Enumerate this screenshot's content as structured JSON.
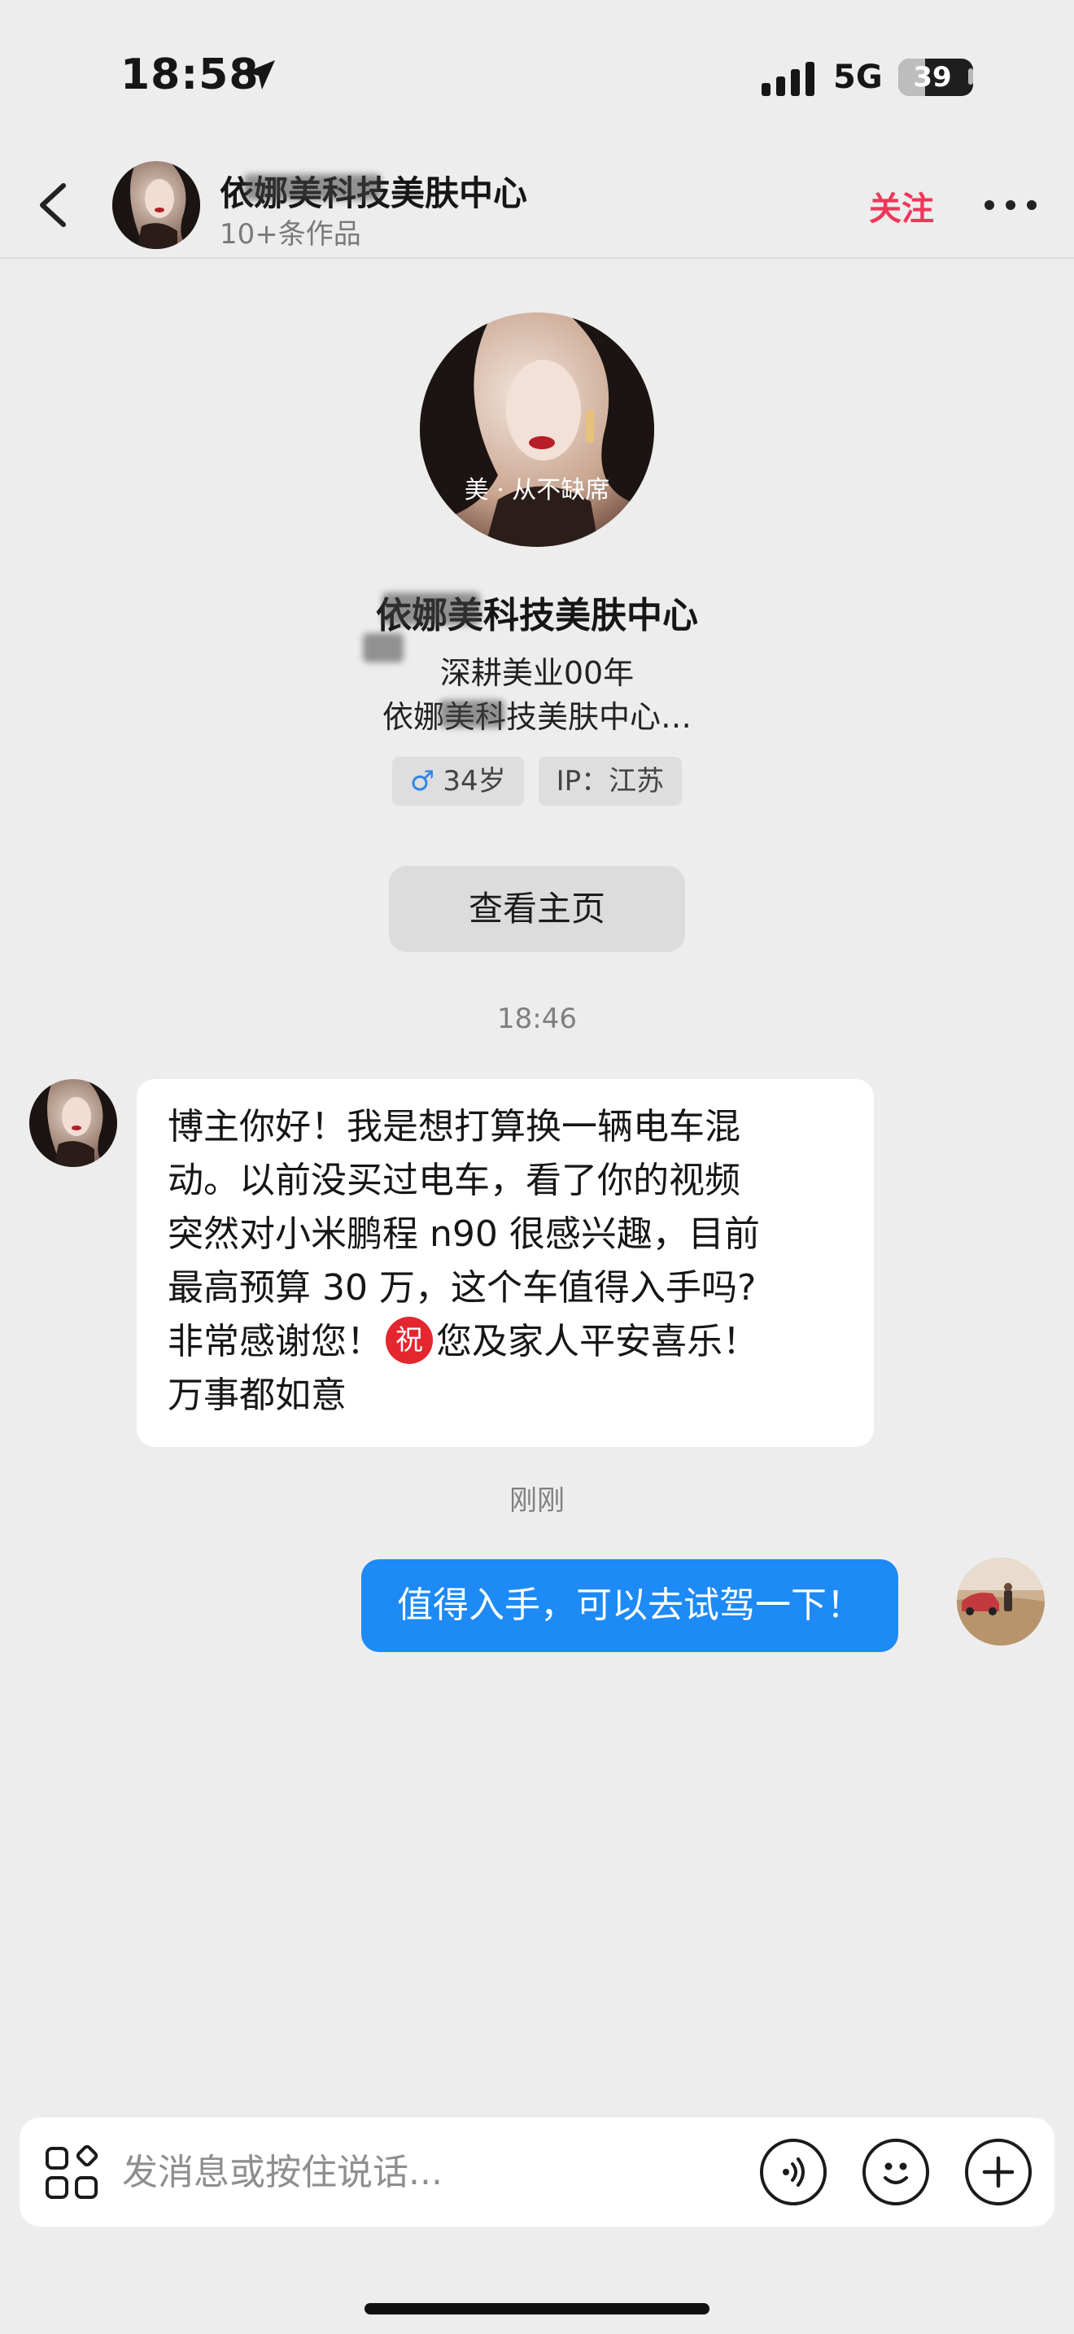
{
  "status_bar": {
    "time": "18:58",
    "network": "5G",
    "battery": "39",
    "battery_level": 0.39
  },
  "header": {
    "name": "依娜美科技美肤中心",
    "subtitle": "10+条作品",
    "follow_label": "关注"
  },
  "profile": {
    "name": "依娜美科技美肤中心",
    "bio_line1": "深耕美业00年",
    "bio_line2": "依娜美科技美肤中心…",
    "gender_symbol": "♂",
    "age": "34岁",
    "ip": "IP：江苏",
    "homepage_button": "查看主页",
    "avatar_caption": "美 · 从不缺席"
  },
  "conversation": {
    "timestamp_1": "18:46",
    "incoming": {
      "line1": "博主你好！我是想打算换一辆电车混",
      "line2": "动。以前没买过电车，看了你的视频",
      "line3": "突然对小米鹏程 n90 很感兴趣，目前",
      "line4": "最高预算 30 万，这个车值得入手吗?",
      "line5a": "非常感谢您！",
      "emoji": "祝",
      "line5b": "您及家人平安喜乐！",
      "line6": "万事都如意"
    },
    "timestamp_2": "刚刚",
    "outgoing": "值得入手，可以去试驾一下！"
  },
  "input_bar": {
    "placeholder": "发消息或按住说话..."
  },
  "colors": {
    "accent_pink": "#f0365a",
    "outgoing_bubble": "#1d8af5",
    "background": "#ededed"
  },
  "icons": [
    "location-arrow-icon",
    "signal-icon",
    "back-chevron-icon",
    "more-dots-icon",
    "apps-grid-icon",
    "voice-icon",
    "emoji-icon",
    "plus-icon"
  ]
}
